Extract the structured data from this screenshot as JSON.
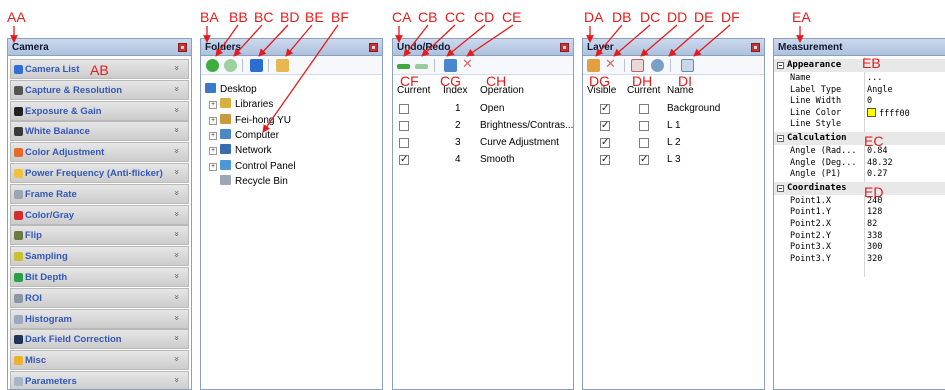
{
  "camera": {
    "title": "Camera",
    "items": [
      {
        "label": "Camera List",
        "icon": "camera-list-icon",
        "color": "#2f6fd6"
      },
      {
        "label": "Capture & Resolution",
        "icon": "capture-icon",
        "color": "#555555"
      },
      {
        "label": "Exposure & Gain",
        "icon": "exposure-icon",
        "color": "#222222"
      },
      {
        "label": "White Balance",
        "icon": "white-balance-icon",
        "color": "#3a3a3a"
      },
      {
        "label": "Color Adjustment",
        "icon": "color-adjustment-icon",
        "color": "#e46b2a"
      },
      {
        "label": "Power Frequency (Anti-flicker)",
        "icon": "power-frequency-icon",
        "color": "#f0c040"
      },
      {
        "label": "Frame Rate",
        "icon": "frame-rate-icon",
        "color": "#9aa6b6"
      },
      {
        "label": "Color/Gray",
        "icon": "color-gray-icon",
        "color": "#d03030"
      },
      {
        "label": "Flip",
        "icon": "flip-icon",
        "color": "#6a7a40"
      },
      {
        "label": "Sampling",
        "icon": "sampling-icon",
        "color": "#c8c030"
      },
      {
        "label": "Bit Depth",
        "icon": "bit-depth-icon",
        "color": "#2aa04a"
      },
      {
        "label": "ROI",
        "icon": "roi-icon",
        "color": "#8a96a8"
      },
      {
        "label": "Histogram",
        "icon": "histogram-icon",
        "color": "#9aa8c0"
      },
      {
        "label": "Dark Field Correction",
        "icon": "dark-field-icon",
        "color": "#223355"
      },
      {
        "label": "Misc",
        "icon": "misc-icon",
        "color": "#f0b030"
      },
      {
        "label": "Parameters",
        "icon": "parameters-icon",
        "color": "#a8b4c8"
      }
    ]
  },
  "folders": {
    "title": "Folders",
    "tree": [
      {
        "label": "Desktop",
        "icon": "desktop-icon",
        "color": "#3a78c8",
        "level": 0,
        "expander": false
      },
      {
        "label": "Libraries",
        "icon": "libraries-icon",
        "color": "#d8b040",
        "level": 1,
        "expander": true
      },
      {
        "label": "Fei-hong YU",
        "icon": "user-folder-icon",
        "color": "#c89a40",
        "level": 1,
        "expander": true
      },
      {
        "label": "Computer",
        "icon": "computer-icon",
        "color": "#4a88c8",
        "level": 1,
        "expander": true
      },
      {
        "label": "Network",
        "icon": "network-icon",
        "color": "#3a6ab0",
        "level": 1,
        "expander": true
      },
      {
        "label": "Control Panel",
        "icon": "control-panel-icon",
        "color": "#4a98d8",
        "level": 1,
        "expander": true
      },
      {
        "label": "Recycle Bin",
        "icon": "recycle-bin-icon",
        "color": "#9aa6b4",
        "level": 1,
        "expander": false
      }
    ]
  },
  "undo": {
    "title": "Undo/Redo",
    "headers": {
      "current": "Current",
      "index": "Index",
      "operation": "Operation"
    },
    "rows": [
      {
        "current": false,
        "index": "1",
        "operation": "Open"
      },
      {
        "current": false,
        "index": "2",
        "operation": "Brightness/Contras..."
      },
      {
        "current": false,
        "index": "3",
        "operation": "Curve Adjustment"
      },
      {
        "current": true,
        "index": "4",
        "operation": "Smooth"
      }
    ]
  },
  "layer": {
    "title": "Layer",
    "headers": {
      "visible": "Visible",
      "current": "Current",
      "name": "Name"
    },
    "rows": [
      {
        "visible": true,
        "current": false,
        "name": "Background"
      },
      {
        "visible": true,
        "current": false,
        "name": "L 1"
      },
      {
        "visible": true,
        "current": false,
        "name": "L 2"
      },
      {
        "visible": true,
        "current": true,
        "name": "L 3"
      }
    ]
  },
  "measurement": {
    "title": "Measurement",
    "categories": [
      {
        "label": "Appearance",
        "rows": [
          {
            "key": "Name",
            "value": "..."
          },
          {
            "key": "Label Type",
            "value": "Angle"
          },
          {
            "key": "Line Width",
            "value": "0"
          },
          {
            "key": "Line Color",
            "value": "ffff00",
            "swatch": "#ffff00"
          },
          {
            "key": "Line Style",
            "value": ""
          }
        ]
      },
      {
        "label": "Calculation",
        "rows": [
          {
            "key": "Angle (Rad...",
            "value": "0.84"
          },
          {
            "key": "Angle (Deg...",
            "value": "48.32"
          },
          {
            "key": "Angle (P1)",
            "value": "0.27"
          }
        ]
      },
      {
        "label": "Coordinates",
        "rows": [
          {
            "key": "Point1.X",
            "value": "240"
          },
          {
            "key": "Point1.Y",
            "value": "128"
          },
          {
            "key": "Point2.X",
            "value": "82"
          },
          {
            "key": "Point2.Y",
            "value": "338"
          },
          {
            "key": "Point3.X",
            "value": "300"
          },
          {
            "key": "Point3.Y",
            "value": "320"
          }
        ]
      }
    ]
  },
  "callouts": {
    "AA": "AA",
    "AB": "AB",
    "BA": "BA",
    "BB": "BB",
    "BC": "BC",
    "BD": "BD",
    "BE": "BE",
    "BF": "BF",
    "CA": "CA",
    "CB": "CB",
    "CC": "CC",
    "CD": "CD",
    "CE": "CE",
    "CF": "CF",
    "CG": "CG",
    "CH": "CH",
    "DA": "DA",
    "DB": "DB",
    "DC": "DC",
    "DD": "DD",
    "DE": "DE",
    "DF": "DF",
    "DG": "DG",
    "DH": "DH",
    "DI": "DI",
    "EA": "EA",
    "EB": "EB",
    "EC": "EC",
    "ED": "ED"
  },
  "colors": {
    "callout": "#e51c1c",
    "titlebar": "#b8c9e3",
    "accent_text": "#3358b8"
  }
}
